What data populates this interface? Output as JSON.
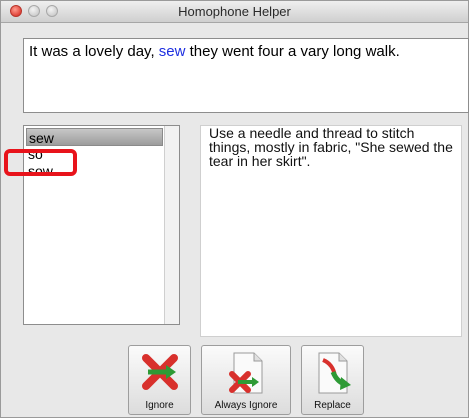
{
  "window": {
    "title": "Homophone Helper"
  },
  "sentence": {
    "before": "It was a lovely day, ",
    "highlight": "sew",
    "after": " they went four a vary long walk."
  },
  "list": {
    "items": [
      {
        "label": "sew",
        "selected": true
      },
      {
        "label": "so",
        "selected": false
      },
      {
        "label": "sow",
        "selected": false
      }
    ]
  },
  "definition": "Use a needle and thread to stitch things, mostly in fabric, \"She sewed the tear in her skirt\".",
  "buttons": {
    "ignore": {
      "label": "Ignore",
      "icon": "red-x-arrow-icon"
    },
    "always_ignore": {
      "label": "Always Ignore",
      "icon": "document-red-x-icon"
    },
    "replace": {
      "label": "Replace",
      "icon": "document-green-arrow-icon"
    }
  },
  "colors": {
    "highlight_word": "#1d2fe0",
    "annotation": "#e8131b"
  }
}
